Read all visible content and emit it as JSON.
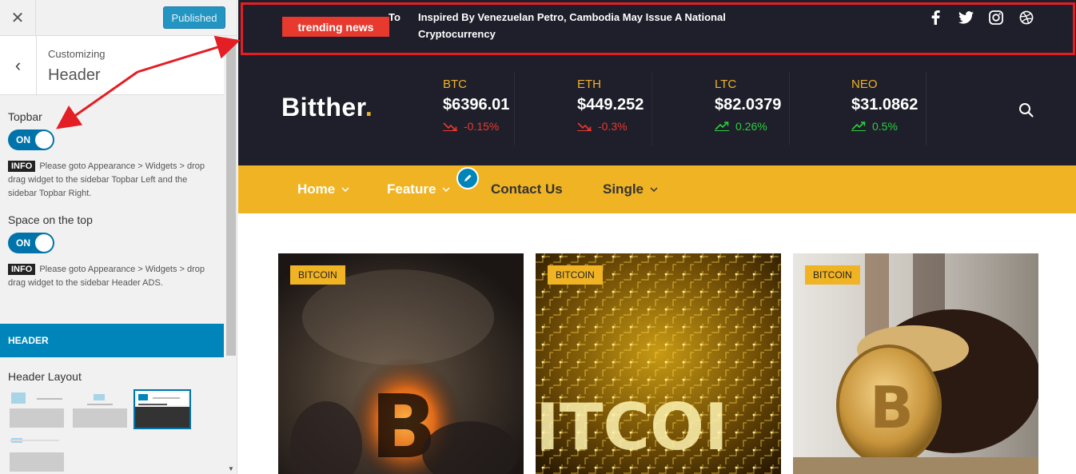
{
  "customizer": {
    "close_icon": "close-icon",
    "publish_label": "Published",
    "breadcrumb": "Customizing",
    "section_title": "Header",
    "topbar": {
      "label": "Topbar",
      "toggle": "ON",
      "info_badge": "INFO",
      "info_text": "Please goto Appearance > Widgets > drop drag widget to the sidebar Topbar Left and the sidebar Topbar Right."
    },
    "space_top": {
      "label": "Space on the top",
      "toggle": "ON",
      "info_badge": "INFO",
      "info_text": "Please goto Appearance > Widgets > drop drag widget to the sidebar Header ADS."
    },
    "header_section": "HEADER",
    "header_layout_label": "Header Layout"
  },
  "preview": {
    "trending": {
      "badge": "trending news",
      "to": "To",
      "headline": "Inspired By Venezuelan Petro, Cambodia May Issue A National Cryptocurrency"
    },
    "social_icons": [
      "facebook-icon",
      "twitter-icon",
      "instagram-icon",
      "dribbble-icon"
    ],
    "logo": {
      "text": "Bitther",
      "dot": "."
    },
    "coins": [
      {
        "name": "BTC",
        "price": "$6396.01",
        "change": "-0.15%",
        "direction": "down"
      },
      {
        "name": "ETH",
        "price": "$449.252",
        "change": "-0.3%",
        "direction": "down"
      },
      {
        "name": "LTC",
        "price": "$82.0379",
        "change": "0.26%",
        "direction": "up"
      },
      {
        "name": "NEO",
        "price": "$31.0862",
        "change": "0.5%",
        "direction": "up"
      }
    ],
    "nav": {
      "home": "Home",
      "feature": "Feature",
      "contact": "Contact Us",
      "single": "Single"
    },
    "cards": [
      {
        "tag": "BITCOIN"
      },
      {
        "tag": "BITCOIN"
      },
      {
        "tag": "BITCOIN"
      }
    ]
  },
  "colors": {
    "accent": "#f0b323",
    "dark_bg": "#1f1f2b",
    "wp_blue": "#0085ba",
    "down": "#e8392e",
    "up": "#2ecc40",
    "highlight": "#e31e24"
  }
}
